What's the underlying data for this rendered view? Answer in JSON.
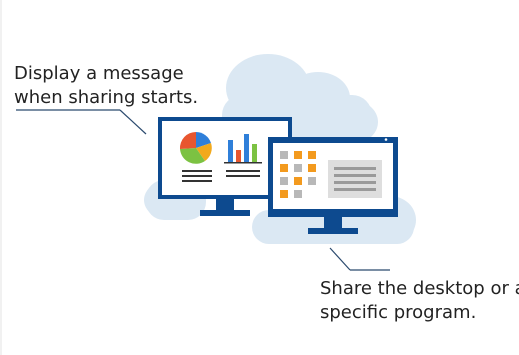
{
  "callouts": {
    "top": {
      "line1": "Display a message",
      "line2": "when sharing starts."
    },
    "bottom": {
      "line1": "Share the desktop or a",
      "line2": "specific program."
    }
  },
  "illustration": {
    "left_monitor": {
      "icon": "pie-and-bar-charts-icon",
      "pie_colors": [
        "#e8562f",
        "#2f7fd9",
        "#f2a91c",
        "#7cc242"
      ],
      "bar_colors": [
        "#2f7fd9",
        "#e8562f",
        "#2f7fd9",
        "#7cc242"
      ],
      "bar_values": [
        0.55,
        0.3,
        0.7,
        0.45
      ]
    },
    "right_monitor": {
      "icon": "app-grid-and-window-icon",
      "tile_colors": [
        "#f39a1e",
        "#b8b8b8",
        "#f39a1e"
      ]
    },
    "colors": {
      "frame": "#0d4a8f",
      "screen": "#ffffff",
      "stand": "#0d4a8f",
      "cloud": "#dbe8f3",
      "leader_line": "#2b4a6e"
    }
  }
}
